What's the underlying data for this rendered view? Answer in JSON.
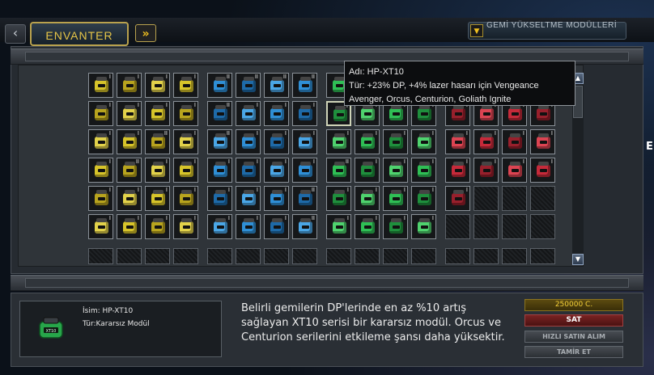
{
  "header": {
    "tab_label": "ENVANTER",
    "prev_icon": "chevron-left-icon",
    "forward_icon": "double-chevron-right-icon",
    "dropdown_icon": "chevron-down-icon",
    "dropdown_label": "GEMİ YÜKSELTME MODÜLLERİ"
  },
  "tooltip": {
    "line1": "Adı: HP-XT10",
    "line2": "Tür: +23% DP, +4% lazer hasarı için Vengeance",
    "line3": "Avenger, Orcus, Centurion, Goliath Ignite"
  },
  "colors": {
    "gold_accent": "#e7c648",
    "module_yellow": "#d7c42a",
    "module_blue": "#2f8fd6",
    "module_green": "#2fbf55",
    "module_red": "#c62a3a",
    "sell_red": "#7a2323"
  },
  "inventory": {
    "groups": [
      {
        "color": "yellow",
        "rows": [
          [
            "I",
            "I",
            "I",
            "I"
          ],
          [
            "I",
            "I",
            "I",
            "I"
          ],
          [
            "I",
            "I",
            "II",
            "I"
          ],
          [
            "I",
            "II",
            "I",
            "I"
          ],
          [
            "I",
            "I",
            "I",
            "I"
          ],
          [
            "I",
            "I",
            "I",
            "I"
          ],
          [
            "",
            "",
            "",
            ""
          ]
        ]
      },
      {
        "color": "blue",
        "rows": [
          [
            "II",
            "II",
            "II",
            "II"
          ],
          [
            "II",
            "I",
            "I",
            "I"
          ],
          [
            "II",
            "I",
            "I",
            "I"
          ],
          [
            "I",
            "I",
            "I",
            "I"
          ],
          [
            "I",
            "I",
            "I",
            "II"
          ],
          [
            "I",
            "I",
            "I",
            "II"
          ],
          [
            "",
            "",
            "",
            ""
          ]
        ]
      },
      {
        "color": "green",
        "rows": [
          [
            "I",
            "I",
            "I",
            "I"
          ],
          [
            "I",
            "I",
            "I",
            "I"
          ],
          [
            "I",
            "I",
            "I",
            "I"
          ],
          [
            "II",
            "I",
            "I",
            "I"
          ],
          [
            "I",
            "I",
            "I",
            "I"
          ],
          [
            "I",
            "I",
            "I",
            "I"
          ],
          [
            "",
            "",
            "",
            ""
          ]
        ]
      },
      {
        "color": "red",
        "rows": [
          [
            "I",
            "I",
            "I",
            "I"
          ],
          [
            "I",
            "I",
            "I",
            "I"
          ],
          [
            "I",
            "I",
            "I",
            "I"
          ],
          [
            "I",
            "I",
            "I",
            "I"
          ],
          [
            "I",
            "",
            "",
            ""
          ],
          [
            "",
            "",
            "",
            ""
          ],
          [
            "",
            "",
            "",
            ""
          ]
        ]
      }
    ],
    "selected": {
      "group": 2,
      "row": 1,
      "col": 0
    }
  },
  "details": {
    "name_label": "İsim: HP-XT10",
    "type_label": "Tür:Kararsız Modül",
    "icon_text": "XT10",
    "description": "Belirli gemilerin DP'lerinde en az %10 artış sağlayan XT10 serisi bir kararsız modül. Orcus ve Centurion serilerini etkileme şansı daha yüksektir."
  },
  "actions": {
    "price": "250000 C.",
    "sell": "SAT",
    "quick_buy": "HIZLI SATIN ALIM",
    "repair": "TAMİR ET"
  },
  "edge": {
    "char": "E"
  }
}
